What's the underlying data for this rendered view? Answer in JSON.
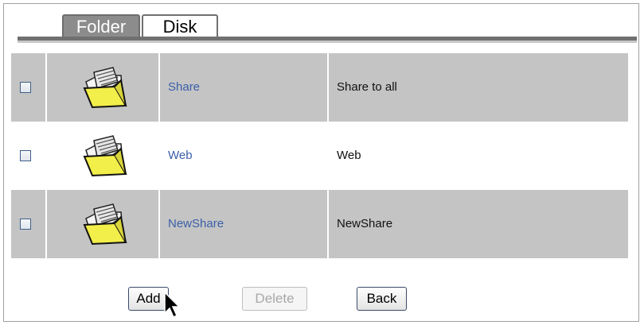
{
  "tabs": [
    {
      "label": "Folder",
      "active": true
    },
    {
      "label": "Disk",
      "active": false
    }
  ],
  "shares": [
    {
      "name": "Share",
      "description": "Share to all",
      "checked": false
    },
    {
      "name": "Web",
      "description": "Web",
      "checked": false
    },
    {
      "name": "NewShare",
      "description": "NewShare",
      "checked": false
    }
  ],
  "buttons": {
    "add": "Add",
    "delete": "Delete",
    "back": "Back"
  },
  "colors": {
    "active_tab": "#8c8c8c",
    "row_gray": "#c4c4c4",
    "link": "#3a5fa8"
  },
  "icons": {
    "folder": "folder-icon",
    "cursor": "mouse-pointer-icon"
  }
}
